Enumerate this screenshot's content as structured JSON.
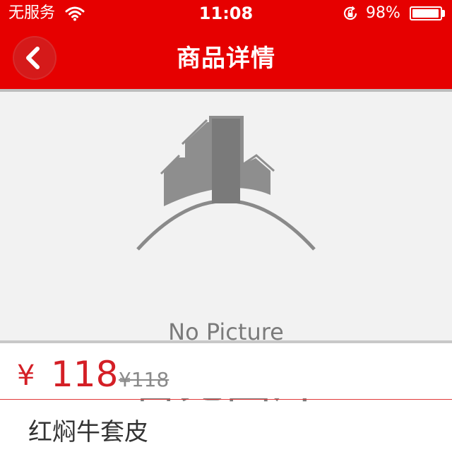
{
  "status_bar": {
    "carrier": "无服务",
    "time": "11:08",
    "battery_percent_text": "98%",
    "battery_level": 0.98,
    "icons": [
      "wifi-icon",
      "rotation-lock-icon",
      "battery-icon"
    ]
  },
  "nav": {
    "title": "商品详情",
    "back_icon": "chevron-left-icon"
  },
  "product_image": {
    "placeholder_en": "No Picture",
    "placeholder_zh": "暂无图片",
    "icon": "city-buildings-icon"
  },
  "price": {
    "symbol": "¥",
    "current": "118",
    "original": "¥118"
  },
  "product": {
    "name": "红焖牛套皮"
  },
  "colors": {
    "brand_red": "#e60000",
    "price_red": "#d41f26",
    "placeholder_gray": "#7b7b7b"
  }
}
